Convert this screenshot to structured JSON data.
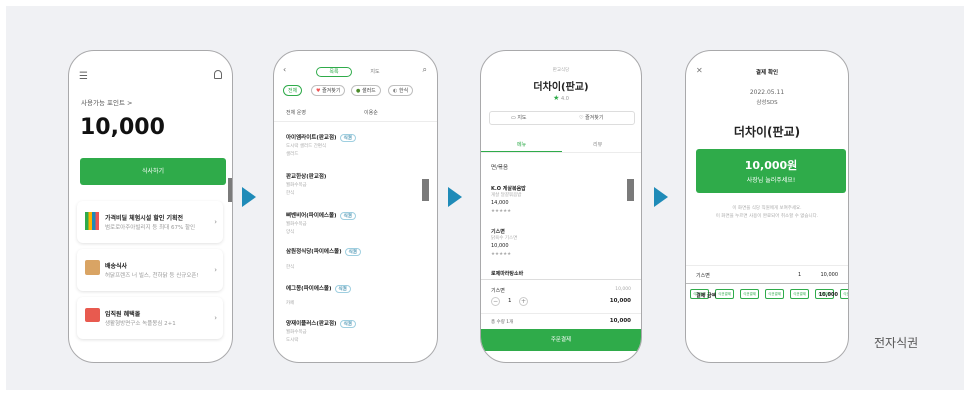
{
  "caption": "전자식권",
  "screen1": {
    "points_label": "사용가능 포인트 >",
    "points_value": "10,000",
    "primary_button": "식사하기",
    "cards": [
      {
        "title": "가격비딜 체험시설 할인 기획전",
        "subtitle": "범로로아주아빌리지 등 최대 67% 할인"
      },
      {
        "title": "배송식사",
        "subtitle": "허닭프렌즈 너 빌스, 천하닭 등 신규오픈!"
      },
      {
        "title": "임직원 혜택몰",
        "subtitle": "생활형방면구소 녹플몽심 2+1"
      }
    ]
  },
  "screen2": {
    "tabs": [
      "목록",
      "지도"
    ],
    "filters": [
      "전체",
      "즐겨찾기",
      "샐러드",
      "한식"
    ],
    "sort_left": "전체 운영",
    "sort_right": "이용순",
    "restaurants": [
      {
        "name": "아이엠라이트(판교점)",
        "tag": "식권",
        "sub": "도시락 샐러드 간편식",
        "meta": "샐러드"
      },
      {
        "name": "판교한상(판교점)",
        "tag": "",
        "sub": "월화수목금",
        "meta": "한식"
      },
      {
        "name": "삐벤비어(파이에스몰)",
        "tag": "식권",
        "sub": "월화수목금",
        "meta": "양식"
      },
      {
        "name": "삼원정식당(파이에스몰)",
        "tag": "식권",
        "sub": "",
        "meta": "한식"
      },
      {
        "name": "에그몽(파이에스몰)",
        "tag": "식권",
        "sub": "",
        "meta": "카페"
      },
      {
        "name": "양재이플러스(판교점)",
        "tag": "식권",
        "sub": "월화수목금",
        "meta": "도시락"
      }
    ]
  },
  "screen3": {
    "header_small": "판교식당",
    "restaurant_name": "더차이(판교)",
    "rating": "4.0",
    "btn_map": "지도",
    "btn_favorite": "즐겨찾기",
    "tab_menu": "메뉴",
    "tab_info": "리뷰",
    "section_label": "면/볶음",
    "menu_items": [
      {
        "name": "K.O 게살볶음밥",
        "sub": "게살 달걀볶음밥",
        "price": "14,000"
      },
      {
        "name": "기스면",
        "sub": "닭육수 기스면",
        "price": "10,000"
      },
      {
        "name": "로제마라탕소바",
        "sub": "",
        "price": ""
      }
    ],
    "cart_item": "기스면",
    "cart_item_price_small": "10,000",
    "cart_qty": "1",
    "cart_item_total": "10,000",
    "cart_summary_label": "총 수량 1개",
    "cart_summary_total": "10,000",
    "order_button": "주문결제"
  },
  "screen4": {
    "title": "결제 확인",
    "date": "2022.05.11",
    "company": "삼성SDS",
    "restaurant_name": "더차이(판교)",
    "amount": "10,000원",
    "amount_sub": "사장님 눌러주세요!",
    "notice_line1": "이 화면을 식당 직원에게 보여주세요.",
    "notice_line2": "이 화면을 누르면 사용이 완료되어 취소할 수 없습니다.",
    "ticket_label": "식권결제",
    "row_item": "기스면",
    "row_qty": "1",
    "row_price": "10,000",
    "total_label": "결제 금액",
    "total_value": "10,000"
  },
  "colors": {
    "green": "#2fab4a",
    "arrow": "#1f8bb8",
    "panel": "#f0f1f4"
  }
}
